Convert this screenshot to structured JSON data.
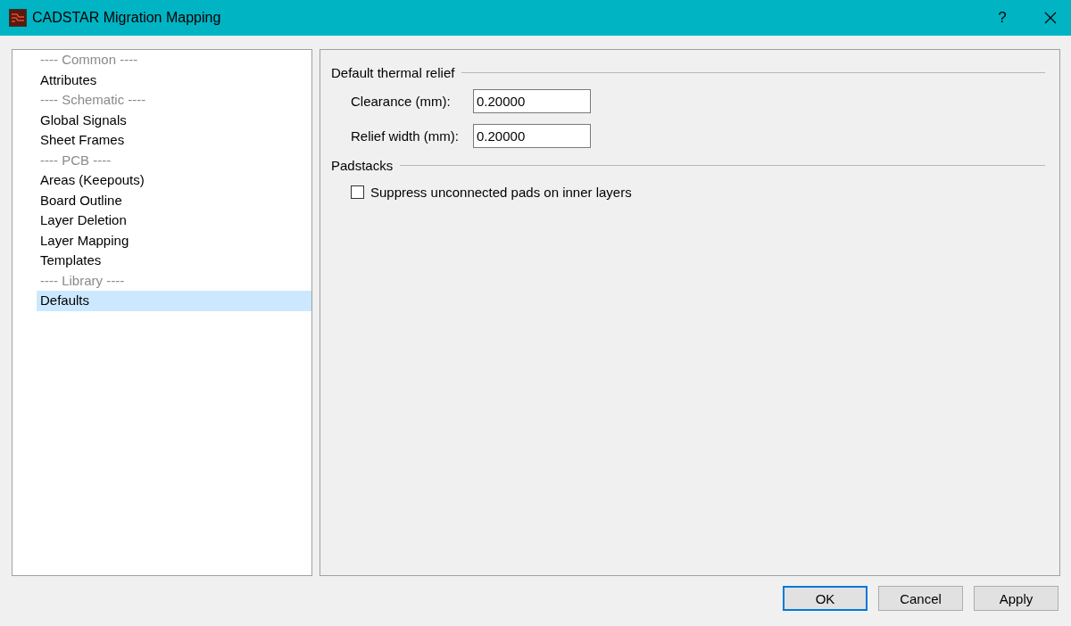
{
  "window": {
    "title": "CADSTAR Migration Mapping",
    "help": "?"
  },
  "sidebar": {
    "items": [
      {
        "kind": "header",
        "label": "---- Common ----"
      },
      {
        "kind": "item",
        "label": "Attributes",
        "selected": false
      },
      {
        "kind": "header",
        "label": "---- Schematic ----"
      },
      {
        "kind": "item",
        "label": "Global Signals",
        "selected": false
      },
      {
        "kind": "item",
        "label": "Sheet Frames",
        "selected": false
      },
      {
        "kind": "header",
        "label": "---- PCB ----"
      },
      {
        "kind": "item",
        "label": "Areas (Keepouts)",
        "selected": false
      },
      {
        "kind": "item",
        "label": "Board Outline",
        "selected": false
      },
      {
        "kind": "item",
        "label": "Layer Deletion",
        "selected": false
      },
      {
        "kind": "item",
        "label": "Layer Mapping",
        "selected": false
      },
      {
        "kind": "item",
        "label": "Templates",
        "selected": false
      },
      {
        "kind": "header",
        "label": "---- Library ----"
      },
      {
        "kind": "item",
        "label": "Defaults",
        "selected": true
      }
    ]
  },
  "panel": {
    "groups": [
      {
        "title": "Default thermal relief",
        "controls": [
          {
            "kind": "field",
            "label": "Clearance (mm):",
            "value": "0.20000"
          },
          {
            "kind": "field",
            "label": "Relief width (mm):",
            "value": "0.20000"
          }
        ]
      },
      {
        "title": "Padstacks",
        "controls": [
          {
            "kind": "checkbox",
            "label": "Suppress unconnected pads on inner layers",
            "checked": false
          }
        ]
      }
    ]
  },
  "buttons": [
    {
      "label": "OK",
      "default": true
    },
    {
      "label": "Cancel",
      "default": false
    },
    {
      "label": "Apply",
      "default": false
    }
  ]
}
